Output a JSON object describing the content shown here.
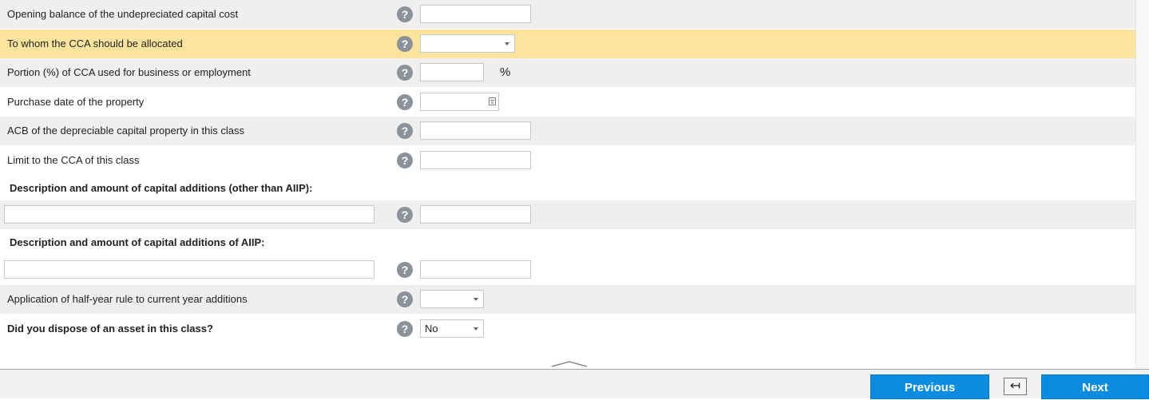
{
  "rows": [
    {
      "label": "Opening balance of the undepreciated capital cost"
    },
    {
      "label": "To whom the CCA should be allocated",
      "value": ""
    },
    {
      "label": "Portion (%) of CCA used for business or employment",
      "unit": "%"
    },
    {
      "label": "Purchase date of the property"
    },
    {
      "label": "ACB of the depreciable capital property in this class"
    },
    {
      "label": "Limit to the CCA of this class"
    }
  ],
  "sections": {
    "other_additions": "Description and amount of capital additions (other than AIIP):",
    "aiip_additions": "Description and amount of capital additions of AIIP:"
  },
  "half_year": {
    "label": "Application of half-year rule to current year additions",
    "value": ""
  },
  "dispose": {
    "label": "Did you dispose of an asset in this class?",
    "value": "No"
  },
  "help_glyph": "?",
  "footer": {
    "previous_label": "Previous",
    "back_glyph": "↤",
    "next_label": "Next"
  },
  "colors": {
    "highlight": "#fde49c",
    "button": "#0a8de0",
    "row_alt": "#efefef"
  }
}
